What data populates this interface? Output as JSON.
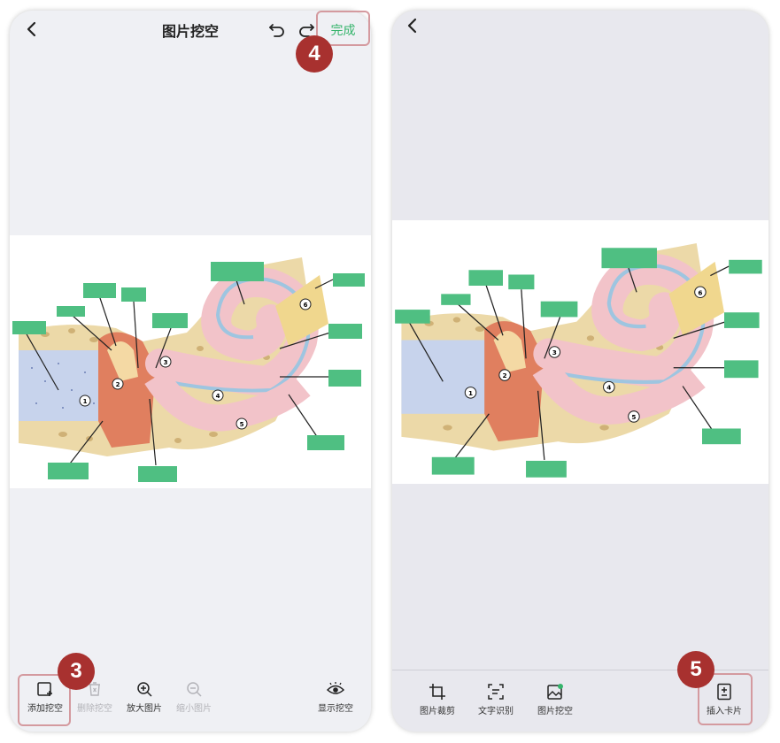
{
  "left_screen": {
    "title": "图片挖空",
    "done_label": "完成",
    "toolbar": [
      {
        "label": "添加挖空",
        "icon": "add-mask-icon",
        "enabled": true
      },
      {
        "label": "删除挖空",
        "icon": "delete-mask-icon",
        "enabled": false
      },
      {
        "label": "放大图片",
        "icon": "zoom-in-icon",
        "enabled": true
      },
      {
        "label": "缩小图片",
        "icon": "zoom-out-icon",
        "enabled": false
      },
      {
        "label": "显示挖空",
        "icon": "eye-icon",
        "enabled": true
      }
    ]
  },
  "right_screen": {
    "toolbar": [
      {
        "label": "图片裁剪",
        "icon": "crop-icon"
      },
      {
        "label": "文字识别",
        "icon": "text-recognition-icon"
      },
      {
        "label": "图片挖空",
        "icon": "image-mask-icon"
      },
      {
        "label": "插入卡片",
        "icon": "insert-card-icon"
      }
    ]
  },
  "step_badges": [
    "3",
    "4",
    "5"
  ],
  "figure_numbers": [
    "1",
    "2",
    "3",
    "4",
    "5",
    "6"
  ],
  "colors": {
    "accent_green": "#35b46b",
    "mask_green": "#4fbf82",
    "badge_red": "#a8312f",
    "highlight_border": "#d49a9f"
  }
}
